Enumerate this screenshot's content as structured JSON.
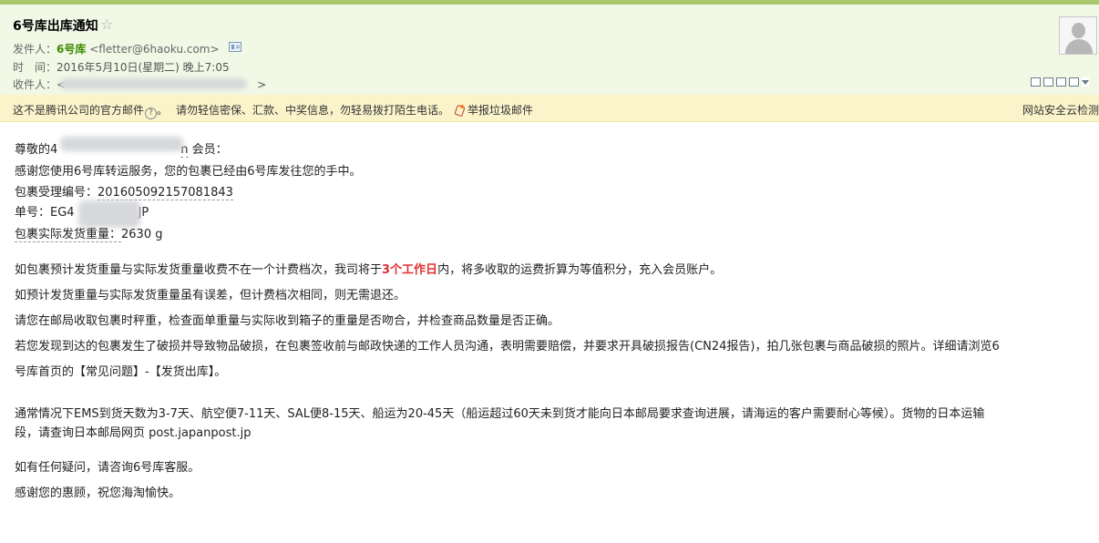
{
  "header": {
    "subject": "6号库出库通知",
    "star": "☆",
    "from_label": "发件人：",
    "sender_name": "6号库",
    "sender_email": "<fletter@6haoku.com>",
    "time_label": "时　间：",
    "time_value": "2016年5月10日(星期二) 晚上7:05",
    "to_label": "收件人：",
    "to_open": "<",
    "to_close": ">"
  },
  "warning": {
    "notice": "这不是腾讯公司的官方邮件",
    "help_glyph": "?",
    "dot": "。",
    "caution": "请勿轻信密保、汇款、中奖信息，勿轻易拨打陌生电话。",
    "report": "举报垃圾邮件",
    "right_text": "网站安全云检测"
  },
  "body": {
    "greeting_prefix": "尊敬的",
    "greeting_partial_start": "4",
    "greeting_partial_end": "n",
    "greeting_suffix": " 会员：",
    "thanks": "感谢您使用6号库转运服务，您的包裹已经由6号库发往您的手中。",
    "tracking_label": "包裹受理编号：",
    "tracking_value": "201605092157081843",
    "order_label": "单号：",
    "order_start": "EG4",
    "order_end": "JP",
    "weight_label": "包裹实际发货重量：",
    "weight_value": "2630 g",
    "p1_a": "如包裹预计发货重量与实际发货重量收费不在一个计费档次，我司将于",
    "p1_red": "3个工作日",
    "p1_b": "内，将多收取的运费折算为等值积分，充入会员账户。",
    "p2": "如预计发货重量与实际发货重量虽有误差，但计费档次相同，则无需退还。",
    "p3": "请您在邮局收取包裹时秤重，检查面单重量与实际收到箱子的重量是否吻合，并检查商品数量是否正确。",
    "p4_line1": "若您发现到达的包裹发生了破损并导致物品破损，在包裹签收前与邮政快递的工作人员沟通，表明需要赔偿，并要求开具破损报告(CN24报告)，拍几张包裹与商品破损的照片。详细请浏览6",
    "p4_line2": "号库首页的【常见问题】-【发货出库】。",
    "p5_line1": "通常情况下EMS到货天数为3-7天、航空便7-11天、SAL便8-15天、船运为20-45天（船运超过60天未到货才能向日本邮局要求查询进展，请海运的客户需要耐心等候）。货物的日本运输",
    "p5_line2": "段，请查询日本邮局网页 post.japanpost.jp",
    "p6": "如有任何疑问，请咨询6号库客服。",
    "p7": "感谢您的惠顾，祝您海淘愉快。"
  }
}
